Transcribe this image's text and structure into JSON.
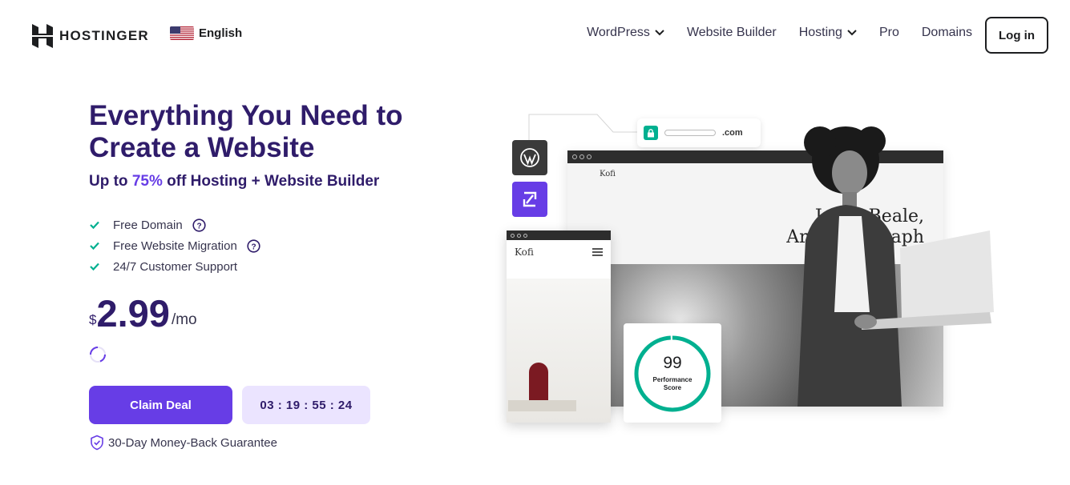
{
  "brand": {
    "name": "HOSTINGER",
    "accent": "#673de6",
    "title_color": "#2f1c6a"
  },
  "language": {
    "label": "English",
    "flag": "us-flag-icon"
  },
  "nav": {
    "items": [
      {
        "label": "WordPress",
        "has_dropdown": true
      },
      {
        "label": "Website Builder",
        "has_dropdown": false
      },
      {
        "label": "Hosting",
        "has_dropdown": true
      },
      {
        "label": "Pro",
        "has_dropdown": false
      },
      {
        "label": "Domains",
        "has_dropdown": false
      }
    ],
    "login_label": "Log in"
  },
  "hero": {
    "title_line1": "Everything You Need to",
    "title_line2": "Create a Website",
    "subtitle_prefix": "Up to ",
    "subtitle_percent": "75%",
    "subtitle_suffix": " off Hosting + Website Builder",
    "features": [
      {
        "label": "Free Domain",
        "has_help": true
      },
      {
        "label": "Free Website Migration",
        "has_help": true
      },
      {
        "label": "24/7 Customer Support",
        "has_help": false
      }
    ],
    "price": {
      "currency": "$",
      "amount": "2.99",
      "period": "/mo"
    },
    "cta_label": "Claim Deal",
    "countdown": "03 : 19 : 55 : 24",
    "guarantee": "30-Day Money-Back Guarantee"
  },
  "illustration": {
    "url_tld": ".com",
    "desktop_brand": "Kofi",
    "desktop_heading_line1": "Joyce Beale,",
    "desktop_heading_line2": "Art photograph",
    "mobile_brand": "Kofi",
    "score_value": "99",
    "score_label_line1": "Performance",
    "score_label_line2": "Score",
    "score_color": "#00b090"
  }
}
